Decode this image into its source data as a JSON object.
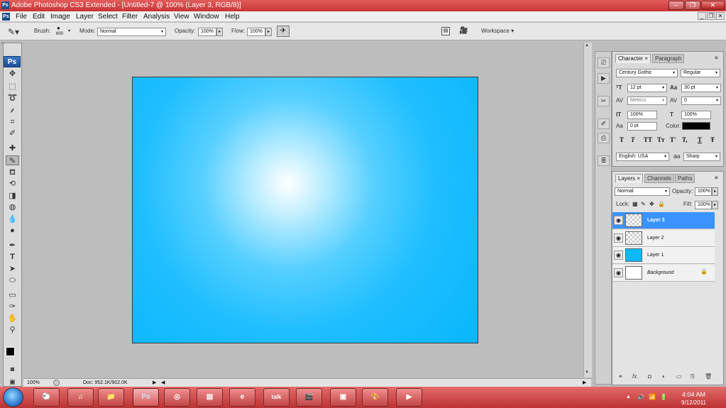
{
  "window": {
    "title": "Adobe Photoshop CS3 Extended - [Untitled-7 @ 100% (Layer 3, RGB/8)]",
    "app_icon": "Ps",
    "min_label": "–",
    "restore_label": "❐",
    "close_label": "✕",
    "doc_min_label": "_",
    "doc_restore_label": "❐",
    "doc_close_label": "✕"
  },
  "menu": [
    "File",
    "Edit",
    "Image",
    "Layer",
    "Select",
    "Filter",
    "Analysis",
    "View",
    "Window",
    "Help"
  ],
  "options_bar": {
    "brush_label": "Brush:",
    "brush_size": "600",
    "mode_label": "Mode:",
    "mode_value": "Normal",
    "opacity_label": "Opacity:",
    "opacity_value": "100%",
    "flow_label": "Flow:",
    "flow_value": "100%",
    "workspace_label": "Workspace ▾"
  },
  "toolbox": {
    "logo": "Ps",
    "tools": [
      "move-tool",
      "marquee-tool",
      "lasso-tool",
      "quick-select-tool",
      "crop-tool",
      "slice-tool",
      "healing-tool",
      "brush-tool",
      "clone-stamp-tool",
      "history-brush-tool",
      "eraser-tool",
      "paint-bucket-tool",
      "blur-tool",
      "dodge-tool",
      "pen-tool",
      "type-tool",
      "path-select-tool",
      "shape-tool",
      "notes-tool",
      "eyedropper-tool",
      "hand-tool",
      "zoom-tool"
    ]
  },
  "status": {
    "zoom": "100%",
    "doc_info": "Doc: 952.1K/902.0K"
  },
  "character_panel": {
    "tabs": [
      "Character ×",
      "Paragraph"
    ],
    "font_family": "Century Gothic",
    "font_style": "Regular",
    "font_size": "12 pt",
    "leading": "30 pt",
    "kerning": "Metrics",
    "tracking": "0",
    "vertical_scale": "100%",
    "horizontal_scale": "100%",
    "baseline_shift": "0 pt",
    "color_label": "Color:",
    "color_value": "#000000",
    "type_styles": [
      "T",
      "T",
      "TT",
      "Tт",
      "T'",
      "T,",
      "T",
      "Ŧ"
    ],
    "language": "English: USA",
    "aa_label": "a",
    "antialias": "Sharp"
  },
  "layers_panel": {
    "tabs": [
      "Layers ×",
      "Channels",
      "Paths"
    ],
    "blend_mode": "Normal",
    "opacity_label": "Opacity:",
    "opacity_value": "100%",
    "lock_label": "Lock:",
    "fill_label": "Fill:",
    "fill_value": "100%",
    "layers": [
      {
        "name": "Layer 3",
        "selected": true,
        "thumb": "transparent"
      },
      {
        "name": "Layer 2",
        "selected": false,
        "thumb": "transparent"
      },
      {
        "name": "Layer 1",
        "selected": false,
        "thumb": "#0ab8fb"
      },
      {
        "name": "Background",
        "selected": false,
        "thumb": "#ffffff",
        "locked": true
      }
    ],
    "footer_icons": [
      "link-icon",
      "fx-icon",
      "mask-icon",
      "adjustment-icon",
      "group-icon",
      "new-layer-icon",
      "delete-icon"
    ]
  },
  "colors": {
    "canvas_center": "#ffffff",
    "canvas_edge": "#08b7fb",
    "selected_layer": "#3a93ff",
    "title_bar": "#c93434"
  },
  "taskbar": {
    "apps": [
      "firefox-sheep-icon",
      "itunes-icon",
      "folder-icon",
      "photoshop-icon",
      "chrome-icon",
      "presentation-icon",
      "ie-icon",
      "talk-icon",
      "media-icon",
      "screen-icon",
      "paint-icon",
      "player-icon"
    ],
    "ps_label": "Ps",
    "talk_label": "talk",
    "time": "4:04 AM",
    "date": "9/12/2011"
  }
}
